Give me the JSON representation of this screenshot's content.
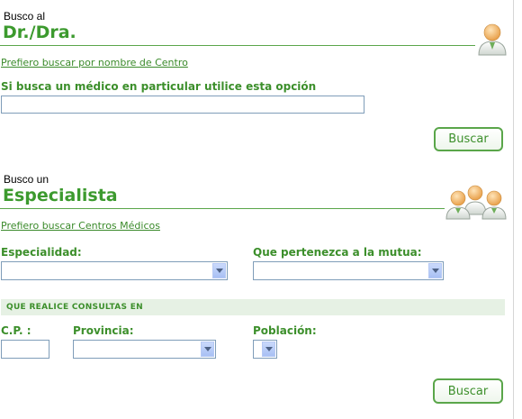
{
  "doctor_section": {
    "small_heading": "Busco al",
    "big_heading": "Dr./Dra.",
    "alt_link": "Prefiero buscar por nombre de Centro",
    "instruction": "Si busca un médico en particular utilice esta opción",
    "search_value": "",
    "button_label": "Buscar",
    "icon": "doctor-icon"
  },
  "specialist_section": {
    "small_heading": "Busco un",
    "big_heading": "Especialista",
    "alt_link": "Prefiero buscar Centros Médicos",
    "specialty_label": "Especialidad:",
    "specialty_value": "",
    "mutual_label": "Que pertenezca a la mutua:",
    "mutual_value": "",
    "band_title": "QUE REALICE CONSULTAS EN",
    "cp_label": "C.P. :",
    "cp_value": "",
    "province_label": "Provincia:",
    "province_value": "",
    "town_label": "Población:",
    "town_value": "",
    "button_label": "Buscar",
    "icon": "doctors-group-icon"
  },
  "colors": {
    "accent_green": "#3c9a2e",
    "band_bg": "#e6f1e4",
    "input_border": "#7f9db9"
  }
}
